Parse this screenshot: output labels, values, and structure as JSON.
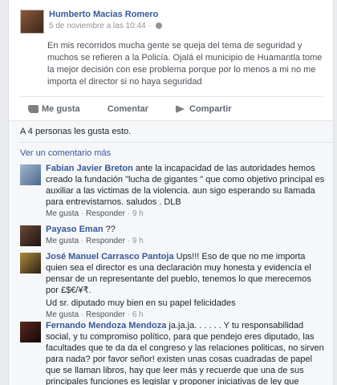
{
  "post": {
    "author": "Humberto Macias Romero",
    "timestamp": "5 de noviembre a las 10:44 ·",
    "text": "En mis recorridos mucha gente se queja del tema de seguridad y muchos se refieren a la Policía. Ojalá el municipio de Huamantla tome la mejor decisión con ese problema porque por lo menos a mi no me importa el director si no haya seguridad"
  },
  "actions": {
    "like": "Me gusta",
    "comment": "Comentar",
    "share": "Compartir"
  },
  "likes_summary": "A 4 personas les gusta esto.",
  "view_more": "Ver un comentario más",
  "comments": [
    {
      "name": "Fabian Javier Breton",
      "text": " ante la incapacidad de las autoridades hemos creado la fundación \"lucha de gigantes \" que como objetivo principal es auxiliar a las victimas de la violencia. aun sigo esperando su llamada para entrevistarnos. saludos . DLB",
      "like": "Me gusta",
      "reply": "Responder",
      "time": "9 h"
    },
    {
      "name": "Payaso Eman",
      "text": " ??",
      "like": "Me gusta",
      "reply": "Responder",
      "time": "9 h"
    },
    {
      "name": "José Manuel Carrasco Pantoja",
      "text": " Ups!!! Eso de que no me importa quien sea el director es una declaración muy honesta y evidencía el pensar de un representante del pueblo, tenemos lo que merecemos por £$€/¥₹.",
      "extra": "Ud sr. diputado muy bien en su papel felicidades",
      "like": "Me gusta",
      "reply": "Responder",
      "time": "6 h"
    },
    {
      "name": "Fernando Mendoza Mendoza",
      "text": " ja.ja.ja. . . . . . Y tu responsabilidad social, y tu compromiso político, para que pendejo eres diputado, las facultades que te da da el congreso y las relaciones politicas, no sirven para nada? por favor señor! existen unas cosas cuadradas de papel que se llaman libros, hay que leer más y recuerde que una de sus principales funciones es legislar y proponer iniciativas de ley que"
    }
  ],
  "colors": {
    "link": "#365899",
    "muted": "#90949c",
    "background": "#e9ebee"
  }
}
